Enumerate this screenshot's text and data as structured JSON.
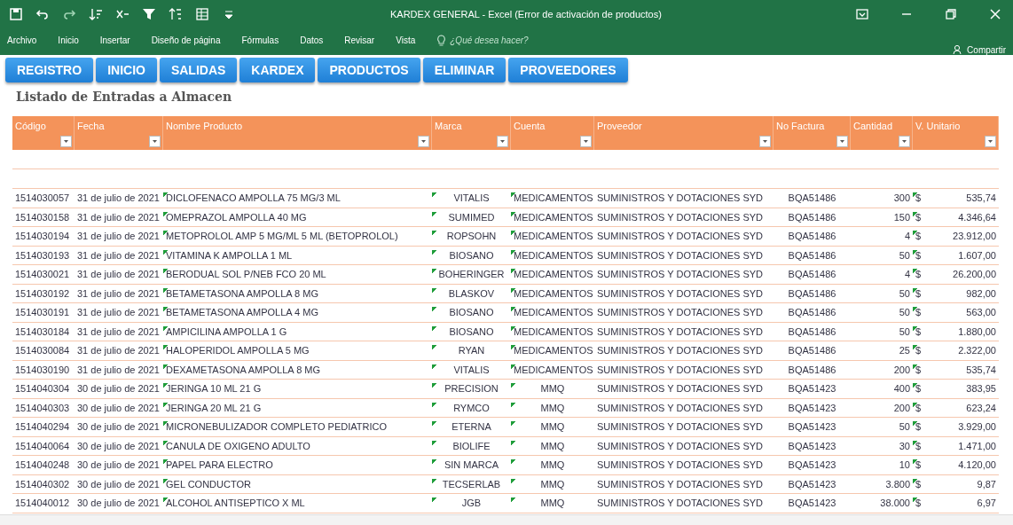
{
  "window": {
    "title": "KARDEX GENERAL - Excel (Error de activación de productos)",
    "quick_access": [
      {
        "kind": "save"
      },
      {
        "kind": "undo"
      },
      {
        "kind": "redo"
      },
      {
        "kind": "sort"
      },
      {
        "kind": "clear-filter"
      },
      {
        "kind": "filter"
      },
      {
        "kind": "sort-az"
      },
      {
        "kind": "form"
      },
      {
        "kind": "more"
      }
    ],
    "controls": [
      {
        "kind": "ribbon"
      },
      {
        "kind": "minimize"
      },
      {
        "kind": "restore"
      },
      {
        "kind": "close"
      }
    ]
  },
  "menu": {
    "items": [
      "Archivo",
      "Inicio",
      "Insertar",
      "Diseño de página",
      "Fórmulas",
      "Datos",
      "Revisar",
      "Vista"
    ],
    "tell_me": {
      "placeholder": "¿Qué desea hacer?"
    },
    "share": "Compartir"
  },
  "nav_buttons": [
    "REGISTRO",
    "INICIO",
    "SALIDAS",
    "KARDEX",
    "PRODUCTOS",
    "ELIMINAR",
    "PROVEEDORES"
  ],
  "heading": "Listado de Entradas a Almacen",
  "table": {
    "columns": [
      "Código",
      "Fecha",
      "Nombre Producto",
      "Marca",
      "Cuenta",
      "Proveedor",
      "No Factura",
      "Cantidad",
      "V. Unitario"
    ],
    "rows": [
      {
        "codigo": "1514030057",
        "fecha": "31 de julio de 2021",
        "producto": "DICLOFENACO AMPOLLA 75 MG/3 ML",
        "marca": "VITALIS",
        "cuenta": "MEDICAMENTOS",
        "proveedor": "SUMINISTROS Y DOTACIONES SYD",
        "factura": "BQA51486",
        "cantidad": "300",
        "moneda": "$",
        "valor": "535,74"
      },
      {
        "codigo": "1514030158",
        "fecha": "31 de julio de 2021",
        "producto": "OMEPRAZOL AMPOLLA 40 MG",
        "marca": "SUMIMED",
        "cuenta": "MEDICAMENTOS",
        "proveedor": "SUMINISTROS Y DOTACIONES SYD",
        "factura": "BQA51486",
        "cantidad": "150",
        "moneda": "$",
        "valor": "4.346,64"
      },
      {
        "codigo": "1514030194",
        "fecha": "31 de julio de 2021",
        "producto": "METOPROLOL AMP 5 MG/ML 5 ML (BETOPROLOL)",
        "marca": "ROPSOHN",
        "cuenta": "MEDICAMENTOS",
        "proveedor": "SUMINISTROS Y DOTACIONES SYD",
        "factura": "BQA51486",
        "cantidad": "4",
        "moneda": "$",
        "valor": "23.912,00"
      },
      {
        "codigo": "1514030193",
        "fecha": "31 de julio de 2021",
        "producto": "VITAMINA K AMPOLLA 1 ML",
        "marca": "BIOSANO",
        "cuenta": "MEDICAMENTOS",
        "proveedor": "SUMINISTROS Y DOTACIONES SYD",
        "factura": "BQA51486",
        "cantidad": "50",
        "moneda": "$",
        "valor": "1.607,00"
      },
      {
        "codigo": "1514030021",
        "fecha": "31 de julio de 2021",
        "producto": "BERODUAL SOL P/NEB FCO 20 ML",
        "marca": "BOHERINGER",
        "cuenta": "MEDICAMENTOS",
        "proveedor": "SUMINISTROS Y DOTACIONES SYD",
        "factura": "BQA51486",
        "cantidad": "4",
        "moneda": "$",
        "valor": "26.200,00"
      },
      {
        "codigo": "1514030192",
        "fecha": "31 de julio de 2021",
        "producto": "BETAMETASONA AMPOLLA 8 MG",
        "marca": "BLASKOV",
        "cuenta": "MEDICAMENTOS",
        "proveedor": "SUMINISTROS Y DOTACIONES SYD",
        "factura": "BQA51486",
        "cantidad": "50",
        "moneda": "$",
        "valor": "982,00"
      },
      {
        "codigo": "1514030191",
        "fecha": "31 de julio de 2021",
        "producto": "BETAMETASONA AMPOLLA 4 MG",
        "marca": "BIOSANO",
        "cuenta": "MEDICAMENTOS",
        "proveedor": "SUMINISTROS Y DOTACIONES SYD",
        "factura": "BQA51486",
        "cantidad": "50",
        "moneda": "$",
        "valor": "563,00"
      },
      {
        "codigo": "1514030184",
        "fecha": "31 de julio de 2021",
        "producto": "AMPICILINA AMPOLLA 1 G",
        "marca": "BIOSANO",
        "cuenta": "MEDICAMENTOS",
        "proveedor": "SUMINISTROS Y DOTACIONES SYD",
        "factura": "BQA51486",
        "cantidad": "50",
        "moneda": "$",
        "valor": "1.880,00"
      },
      {
        "codigo": "1514030084",
        "fecha": "31 de julio de 2021",
        "producto": "HALOPERIDOL AMPOLLA 5 MG",
        "marca": "RYAN",
        "cuenta": "MEDICAMENTOS",
        "proveedor": "SUMINISTROS Y DOTACIONES SYD",
        "factura": "BQA51486",
        "cantidad": "25",
        "moneda": "$",
        "valor": "2.322,00"
      },
      {
        "codigo": "1514030190",
        "fecha": "31 de julio de 2021",
        "producto": "DEXAMETASONA AMPOLLA 8 MG",
        "marca": "VITALIS",
        "cuenta": "MEDICAMENTOS",
        "proveedor": "SUMINISTROS Y DOTACIONES SYD",
        "factura": "BQA51486",
        "cantidad": "200",
        "moneda": "$",
        "valor": "535,74"
      },
      {
        "codigo": "1514040304",
        "fecha": "30 de julio de 2021",
        "producto": "JERINGA 10 ML 21 G",
        "marca": "PRECISION",
        "cuenta": "MMQ",
        "proveedor": "SUMINISTROS Y DOTACIONES SYD",
        "factura": "BQA51423",
        "cantidad": "400",
        "moneda": "$",
        "valor": "383,95"
      },
      {
        "codigo": "1514040303",
        "fecha": "30 de julio de 2021",
        "producto": "JERINGA 20 ML 21 G",
        "marca": "RYMCO",
        "cuenta": "MMQ",
        "proveedor": "SUMINISTROS Y DOTACIONES SYD",
        "factura": "BQA51423",
        "cantidad": "200",
        "moneda": "$",
        "valor": "623,24"
      },
      {
        "codigo": "1514040294",
        "fecha": "30 de julio de 2021",
        "producto": "MICRONEBULIZADOR COMPLETO PEDIATRICO",
        "marca": "ETERNA",
        "cuenta": "MMQ",
        "proveedor": "SUMINISTROS Y DOTACIONES SYD",
        "factura": "BQA51423",
        "cantidad": "50",
        "moneda": "$",
        "valor": "3.929,00"
      },
      {
        "codigo": "1514040064",
        "fecha": "30 de julio de 2021",
        "producto": "CANULA DE OXIGENO ADULTO",
        "marca": "BIOLIFE",
        "cuenta": "MMQ",
        "proveedor": "SUMINISTROS Y DOTACIONES SYD",
        "factura": "BQA51423",
        "cantidad": "30",
        "moneda": "$",
        "valor": "1.471,00"
      },
      {
        "codigo": "1514040248",
        "fecha": "30 de julio de 2021",
        "producto": "PAPEL PARA ELECTRO",
        "marca": "SIN MARCA",
        "cuenta": "MMQ",
        "proveedor": "SUMINISTROS Y DOTACIONES SYD",
        "factura": "BQA51423",
        "cantidad": "10",
        "moneda": "$",
        "valor": "4.120,00"
      },
      {
        "codigo": "1514040302",
        "fecha": "30 de julio de 2021",
        "producto": "GEL CONDUCTOR",
        "marca": "TECSERLAB",
        "cuenta": "MMQ",
        "proveedor": "SUMINISTROS Y DOTACIONES SYD",
        "factura": "BQA51423",
        "cantidad": "3.800",
        "moneda": "$",
        "valor": "9,87"
      },
      {
        "codigo": "1514040012",
        "fecha": "30 de julio de 2021",
        "producto": "ALCOHOL ANTISEPTICO X ML",
        "marca": "JGB",
        "cuenta": "MMQ",
        "proveedor": "SUMINISTROS Y DOTACIONES SYD",
        "factura": "BQA51423",
        "cantidad": "38.000",
        "moneda": "$",
        "valor": "6,97"
      }
    ]
  }
}
